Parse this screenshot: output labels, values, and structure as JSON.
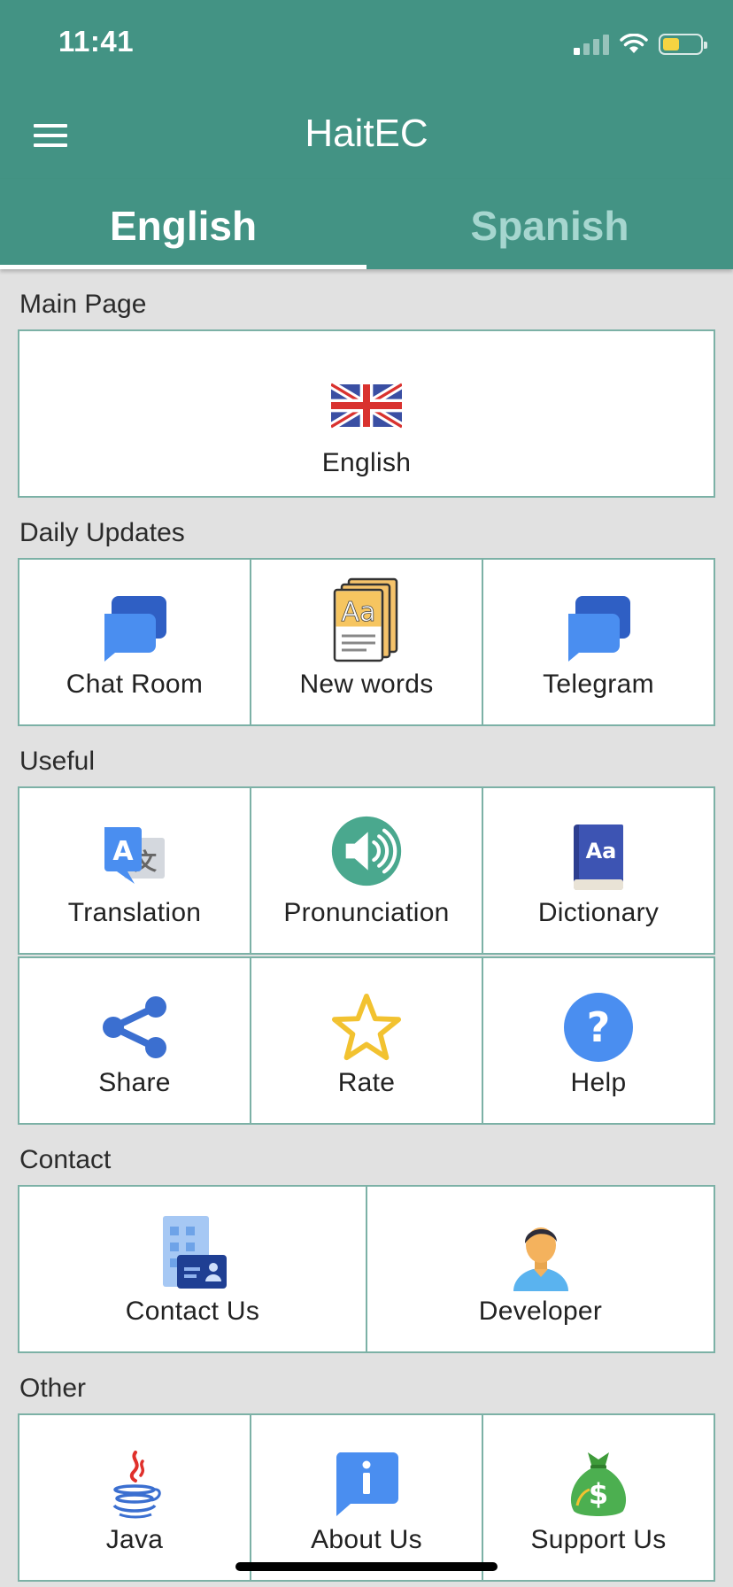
{
  "status_bar": {
    "time": "11:41"
  },
  "app_bar": {
    "title": "HaitEC"
  },
  "tabs": [
    {
      "label": "English",
      "active": true
    },
    {
      "label": "Spanish",
      "active": false
    }
  ],
  "sections": {
    "main": {
      "title": "Main Page",
      "items": [
        {
          "label": "English",
          "icon": "uk-flag-icon"
        }
      ]
    },
    "daily": {
      "title": "Daily Updates",
      "items": [
        {
          "label": "Chat Room",
          "icon": "chat-bubbles-icon"
        },
        {
          "label": "New words",
          "icon": "flashcards-icon"
        },
        {
          "label": "Telegram",
          "icon": "chat-bubbles-icon"
        }
      ]
    },
    "useful": {
      "title": "Useful",
      "items": [
        {
          "label": "Translation",
          "icon": "translate-icon"
        },
        {
          "label": "Pronunciation",
          "icon": "speaker-icon"
        },
        {
          "label": "Dictionary",
          "icon": "dictionary-icon"
        },
        {
          "label": "Share",
          "icon": "share-icon"
        },
        {
          "label": "Rate",
          "icon": "star-icon"
        },
        {
          "label": "Help",
          "icon": "help-icon"
        }
      ]
    },
    "contact": {
      "title": "Contact",
      "items": [
        {
          "label": "Contact Us",
          "icon": "contact-card-icon"
        },
        {
          "label": "Developer",
          "icon": "person-icon"
        }
      ]
    },
    "other": {
      "title": "Other",
      "items": [
        {
          "label": "Java",
          "icon": "java-icon"
        },
        {
          "label": "About Us",
          "icon": "info-icon"
        },
        {
          "label": "Support Us",
          "icon": "money-bag-icon"
        }
      ]
    }
  },
  "colors": {
    "header": "#439384",
    "tab_inactive": "#a6d6cf",
    "border": "#7cb1a6",
    "background": "#e1e1e1"
  }
}
